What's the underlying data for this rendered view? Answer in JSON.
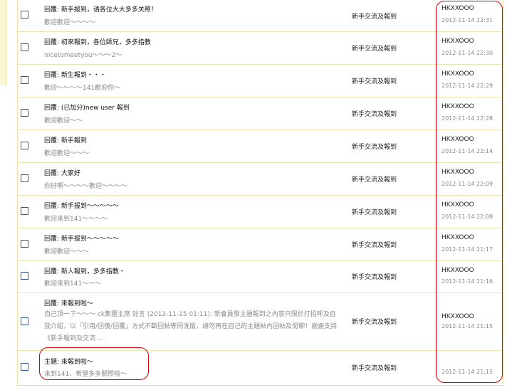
{
  "rows": [
    {
      "title": "回覆: 新手报到，请各位大大多多关照！",
      "preview": "歡迎歡迎～～～～",
      "forum": "新手交流及報到",
      "author": "HKXXOOO",
      "time": "2012-11-14 22:31"
    },
    {
      "title": "回覆: 初來報到，各位師兄，多多指教",
      "preview": "nicetomeetyou～～～2～",
      "forum": "新手交流及報到",
      "author": "HKXXOOO",
      "time": "2012-11-14 22:30"
    },
    {
      "title": "回覆: 新生報到・・・",
      "preview": "歡迎～～～～141歡迎你～",
      "forum": "新手交流及報到",
      "author": "HKXXOOO",
      "time": "2012-11-14 22:29"
    },
    {
      "title": "回覆: (已加分)new user 報到",
      "preview": "歡迎歡迎～～",
      "forum": "新手交流及報到",
      "author": "HKXXOOO",
      "time": "2012-11-14 22:28"
    },
    {
      "title": "回覆: 新手報到",
      "preview": "歡迎歡迎～～～",
      "forum": "新手交流及報到",
      "author": "HKXXOOO",
      "time": "2012-11-14 22:14"
    },
    {
      "title": "回覆: 大家好",
      "preview": "你好啊～～～～歡迎～～～～",
      "forum": "新手交流及報到",
      "author": "HKXXOOO",
      "time": "2012-11-14 22:09"
    },
    {
      "title": "回覆: 新手报到～～～～～",
      "preview": "歡迎來到141～～～～",
      "forum": "新手交流及報到",
      "author": "HKXXOOO",
      "time": "2012-11-14 22:08"
    },
    {
      "title": "回覆: 新手报到～～～～～",
      "preview": "歡迎歡迎～～～",
      "forum": "新手交流及報到",
      "author": "HKXXOOO",
      "time": "2012-11-14 21:17"
    },
    {
      "title": "回覆: 新人報到，多多指教・",
      "preview": "歡迎來到141～～～",
      "forum": "新手交流及報到",
      "author": "HKXXOOO",
      "time": "2012-11-14 21:16"
    },
    {
      "title": "回覆: 來報到啦～",
      "preview": "自己頂一下～～～ ck集團主席 註言 (2012-11-15 01:11): 新會員發主題報到之內容只限於打招呼及自我介紹，以『引用/回復/回覆』方式不斷回帖等同洗版，請勿再在自己的主題帖內回帖及閒聊！謝謝支持《新手報到及交流 …",
      "forum": "新手交流及報到",
      "author": "HKXXOOO",
      "time": "2012-11-14 21:15"
    },
    {
      "title": "主題: 來報到啦～",
      "preview": "來到141，希望多多關照啦～",
      "forum": "新手交流及報到",
      "author": "",
      "time": "2012-11-14 21:15"
    }
  ]
}
